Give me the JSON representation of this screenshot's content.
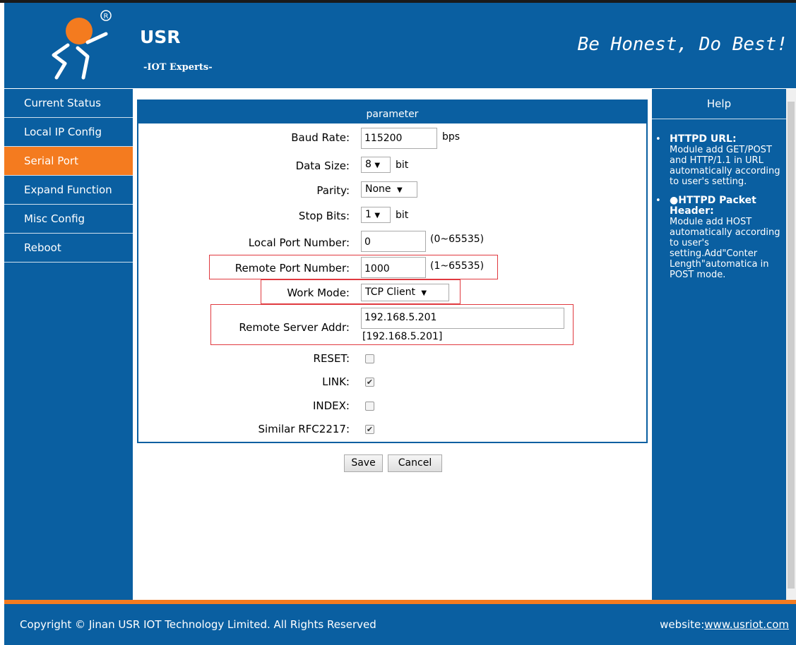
{
  "header": {
    "brand": "USR",
    "subtitle": "-IOT Experts-",
    "slogan": "Be Honest, Do Best!"
  },
  "sidebar": {
    "items": [
      {
        "label": "Current Status",
        "active": false
      },
      {
        "label": "Local IP Config",
        "active": false
      },
      {
        "label": "Serial Port",
        "active": true
      },
      {
        "label": "Expand Function",
        "active": false
      },
      {
        "label": "Misc Config",
        "active": false
      },
      {
        "label": "Reboot",
        "active": false
      }
    ]
  },
  "panel": {
    "title": "parameter",
    "baud_rate": {
      "label": "Baud Rate:",
      "value": "115200",
      "unit": "bps"
    },
    "data_size": {
      "label": "Data Size:",
      "value": "8",
      "unit": "bit"
    },
    "parity": {
      "label": "Parity:",
      "value": "None"
    },
    "stop_bits": {
      "label": "Stop Bits:",
      "value": "1",
      "unit": "bit"
    },
    "local_port": {
      "label": "Local Port Number:",
      "value": "0",
      "range": "(0~65535)"
    },
    "remote_port": {
      "label": "Remote Port Number:",
      "value": "1000",
      "range": "(1~65535)"
    },
    "work_mode": {
      "label": "Work Mode:",
      "value": "TCP Client"
    },
    "remote_server": {
      "label": "Remote Server Addr:",
      "value": "192.168.5.201",
      "resolved": "[192.168.5.201]"
    },
    "reset": {
      "label": "RESET:",
      "checked": false
    },
    "link": {
      "label": "LINK:",
      "checked": true
    },
    "index": {
      "label": "INDEX:",
      "checked": false
    },
    "rfc2217": {
      "label": "Similar RFC2217:",
      "checked": true
    }
  },
  "buttons": {
    "save": "Save",
    "cancel": "Cancel"
  },
  "help": {
    "title": "Help",
    "items": [
      {
        "heading": "HTTPD URL:",
        "text": "Module add GET/POST and HTTP/1.1 in URL automatically according to user's setting."
      },
      {
        "heading": "●HTTPD Packet Header:",
        "text": "Module add HOST automatically according to user's setting.Add\"Conter Length\"automatica in POST mode."
      }
    ]
  },
  "footer": {
    "copyright": "Copyright © Jinan USR IOT Technology Limited. All Rights Reserved",
    "website_prefix": "website:",
    "website_link": "www.usriot.com"
  },
  "colors": {
    "brand_blue": "#0a5fa1",
    "accent_orange": "#f47b1f",
    "highlight_red": "#e0393f"
  }
}
